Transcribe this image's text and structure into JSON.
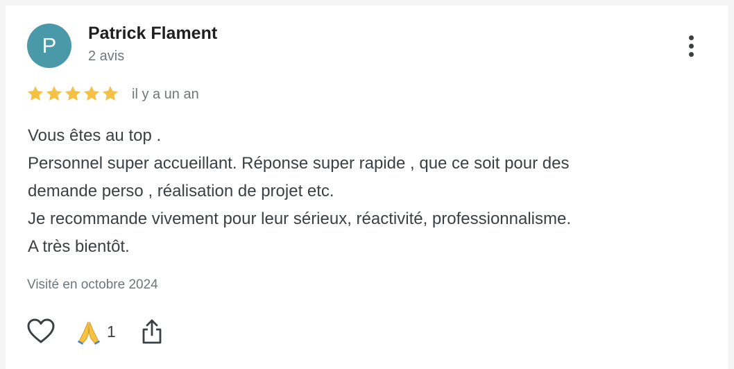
{
  "review": {
    "author": {
      "initial": "P",
      "name": "Patrick Flament",
      "review_count": "2 avis",
      "avatar_color": "#4a99a9"
    },
    "rating": 5,
    "max_rating": 5,
    "star_color": "#f4c144",
    "date": "il y a un an",
    "text_lines": [
      "Vous êtes au top .",
      "Personnel super accueillant. Réponse super rapide , que ce soit pour des",
      "demande perso , réalisation de projet etc.",
      "Je recommande vivement pour leur sérieux, réactivité, professionnalisme.",
      "A très bientôt."
    ],
    "visited": "Visité en octobre 2024",
    "reactions": {
      "emoji_icon": "folded-hands-icon",
      "count": "1"
    },
    "icons": {
      "more": "more-vertical-icon",
      "like": "heart-icon",
      "share": "share-icon"
    }
  }
}
